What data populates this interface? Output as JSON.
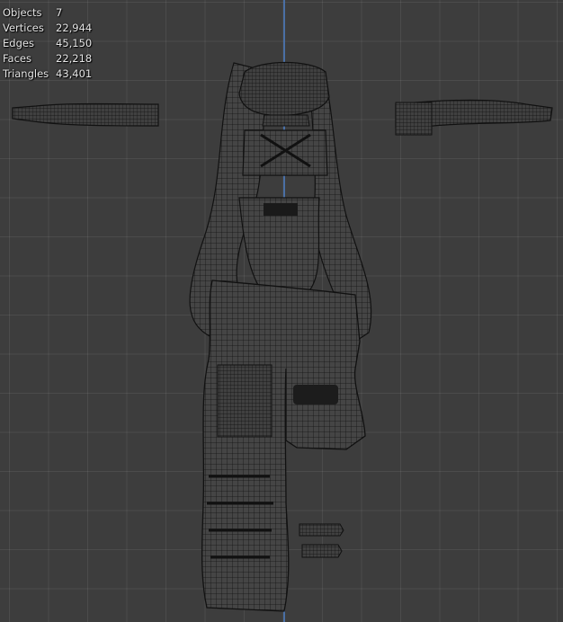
{
  "viewport": {
    "axis_color": "#4a6fa5",
    "background": "#3d3d3d",
    "wire_color": "#111111"
  },
  "overlay_stats": [
    {
      "label": "Objects",
      "value": "7"
    },
    {
      "label": "Vertices",
      "value": "22,944"
    },
    {
      "label": "Edges",
      "value": "45,150"
    },
    {
      "label": "Faces",
      "value": "22,218"
    },
    {
      "label": "Triangles",
      "value": "43,401"
    }
  ]
}
